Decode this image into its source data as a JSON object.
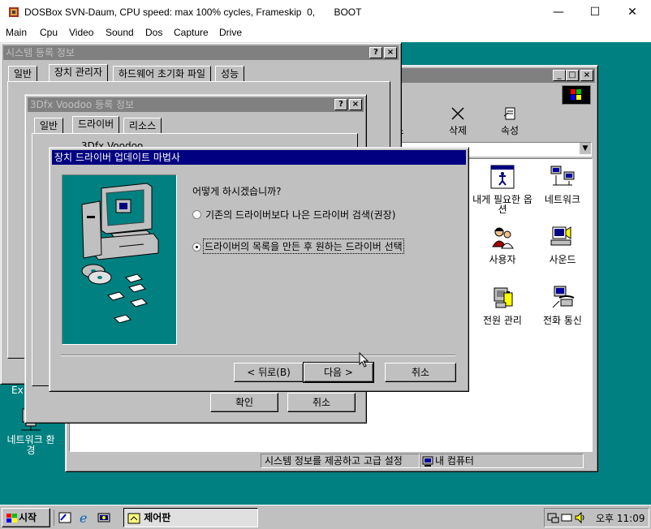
{
  "host": {
    "title": "DOSBox SVN-Daum, CPU speed: max 100% cycles, Frameskip  0,       BOOT",
    "minimize": "—",
    "maximize": "☐",
    "close": "✕",
    "menu": [
      "Main",
      "Cpu",
      "Video",
      "Sound",
      "Dos",
      "Capture",
      "Drive"
    ]
  },
  "sysprops": {
    "title": "시스템 등록 정보",
    "help": "?",
    "close": "×",
    "tabs": [
      "일반",
      "장치 관리자",
      "하드웨어 초기화 파일",
      "성능"
    ]
  },
  "controlpanel": {
    "toolbar": {
      "undo_label": "행 취소",
      "delete_label": "삭제",
      "props_label": "속성"
    },
    "items": [
      {
        "label": "내게 필요한 옵션"
      },
      {
        "label": "네트워크"
      },
      {
        "label": "사용자"
      },
      {
        "label": "사운드"
      },
      {
        "label": "전원 관리"
      },
      {
        "label": "전화 통신"
      }
    ],
    "status_left": "시스템 정보를 제공하고 고급 설정",
    "status_right": "내 컴퓨터"
  },
  "voodoo": {
    "title": "3Dfx Voodoo 등록 정보",
    "tabs": [
      "일반",
      "드라이버",
      "리소스"
    ],
    "device_name": "3Dfx Voodoo",
    "ok": "확인",
    "cancel": "취소"
  },
  "wizard": {
    "title": "장치 드라이버 업데이트 마법사",
    "question": "어떻게 하시겠습니까?",
    "option1": "기존의 드라이버보다 나은 드라이버 검색(권장)",
    "option2": "드라이버의 목록을 만든 후 원하는 드라이버 선택",
    "selected": 2,
    "back": "< 뒤로(B)",
    "next": "다음 >",
    "cancel": "취소"
  },
  "desktop": {
    "partial_label": "Ex",
    "network_env_label": "네트워크 환경"
  },
  "taskbar": {
    "start": "시작",
    "task": "제어판",
    "clock": "오후 11:09"
  },
  "colors": {
    "desktop": "#008080",
    "active_title": "#000080",
    "inactive_title": "#808080",
    "face": "#c0c0c0"
  }
}
